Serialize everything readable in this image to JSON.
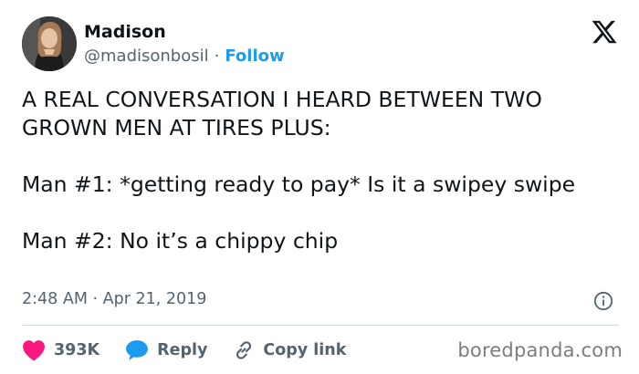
{
  "author": {
    "name": "Madison",
    "handle": "@madisonbosil",
    "separator": "·",
    "follow_label": "Follow"
  },
  "tweet": {
    "lines": [
      "A REAL CONVERSATION I HEARD BETWEEN TWO GROWN MEN AT TIRES PLUS:",
      "Man #1: *getting ready to pay* Is it a swipey swipe",
      "Man #2: No it’s a chippy chip"
    ],
    "time": "2:48 AM",
    "date_separator": "·",
    "date": "Apr 21, 2019"
  },
  "actions": {
    "likes": "393K",
    "reply_label": "Reply",
    "copy_link_label": "Copy link"
  },
  "watermark": "boredpanda.com",
  "icons": {
    "brand": "x-logo-icon",
    "info": "info-icon",
    "like": "heart-icon",
    "reply": "speech-bubble-icon",
    "copy": "link-icon"
  },
  "colors": {
    "like": "#f91880",
    "reply": "#1d9bf0",
    "follow": "#1d9bf0",
    "secondary_text": "#536471"
  }
}
